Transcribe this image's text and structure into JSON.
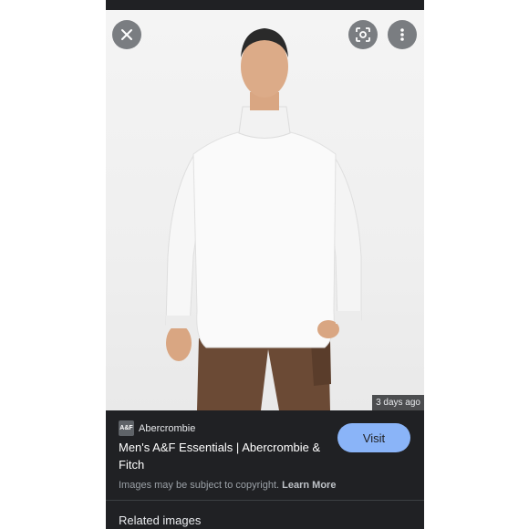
{
  "viewer": {
    "close_icon": "close-icon",
    "lens_icon": "google-lens-icon",
    "more_icon": "more-vert-icon",
    "timestamp": "3 days ago"
  },
  "result": {
    "source_badge": "A&F",
    "source_name": "Abercrombie",
    "title": "Men's A&F Essentials | Abercrombie & Fitch",
    "visit_label": "Visit",
    "copyright_text": "Images may be subject to copyright.",
    "learn_more_label": "Learn More"
  },
  "related": {
    "heading": "Related images"
  },
  "colors": {
    "dark_bg": "#202124",
    "accent_blue": "#8ab4f8"
  }
}
